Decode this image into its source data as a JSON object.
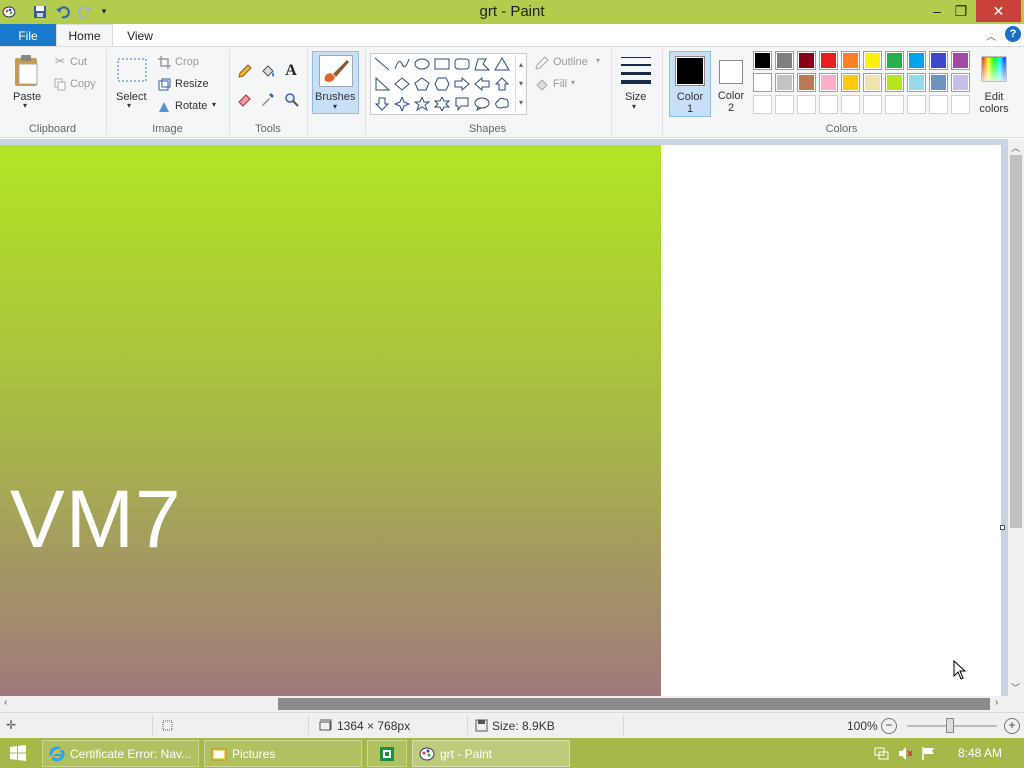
{
  "window": {
    "title": "grt - Paint",
    "minimize": "–",
    "restore": "❐",
    "close": "✕"
  },
  "tabs": {
    "file": "File",
    "home": "Home",
    "view": "View",
    "help": "?"
  },
  "clipboard": {
    "paste": "Paste",
    "cut": "Cut",
    "copy": "Copy",
    "group": "Clipboard"
  },
  "image": {
    "select": "Select",
    "crop": "Crop",
    "resize": "Resize",
    "rotate": "Rotate",
    "group": "Image"
  },
  "tools": {
    "group": "Tools",
    "text_tool": "A"
  },
  "brushes": {
    "label": "Brushes"
  },
  "shapes": {
    "outline": "Outline",
    "fill": "Fill",
    "group": "Shapes"
  },
  "size": {
    "label": "Size"
  },
  "colors": {
    "color1": "Color 1",
    "color2": "Color 2",
    "edit": "Edit colors",
    "group": "Colors",
    "color1_value": "#000000",
    "color2_value": "#ffffff",
    "palette_row1": [
      "#000000",
      "#7f7f7f",
      "#880015",
      "#ed1c24",
      "#ff7f27",
      "#fff200",
      "#22b14c",
      "#00a2e8",
      "#3f48cc",
      "#a349a4"
    ],
    "palette_row2": [
      "#ffffff",
      "#c3c3c3",
      "#b97a57",
      "#ffaec9",
      "#ffc90e",
      "#efe4b0",
      "#b5e61d",
      "#99d9ea",
      "#7092be",
      "#c8bfe7"
    ],
    "palette_row3": [
      "#ffffff",
      "#ffffff",
      "#ffffff",
      "#ffffff",
      "#ffffff",
      "#ffffff",
      "#ffffff",
      "#ffffff",
      "#ffffff",
      "#ffffff"
    ]
  },
  "canvas": {
    "text": "VM7"
  },
  "status": {
    "dimensions": "1364 × 768px",
    "size": "Size: 8.9KB",
    "zoom": "100%",
    "zoom_minus": "−",
    "zoom_plus": "+"
  },
  "taskbar": {
    "items": [
      "Certificate Error: Nav...",
      "Pictures",
      "",
      "grt - Paint"
    ],
    "clock": "8:48 AM"
  }
}
